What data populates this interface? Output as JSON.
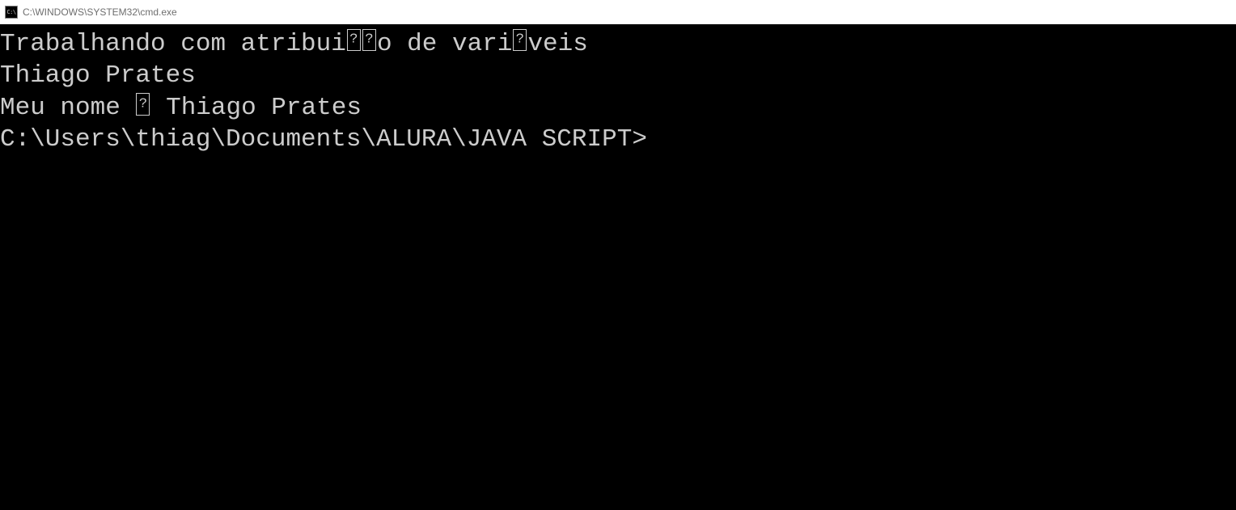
{
  "titlebar": {
    "icon_label": "C:\\",
    "title": "C:\\WINDOWS\\SYSTEM32\\cmd.exe"
  },
  "terminal": {
    "line1_part1": "Trabalhando com atribui",
    "line1_part2": "o de vari",
    "line1_part3": "veis",
    "line2": "Thiago Prates",
    "line3_part1": "Meu nome ",
    "line3_part2": " Thiago Prates",
    "blank": "",
    "prompt": "C:\\Users\\thiag\\Documents\\ALURA\\JAVA SCRIPT>"
  }
}
